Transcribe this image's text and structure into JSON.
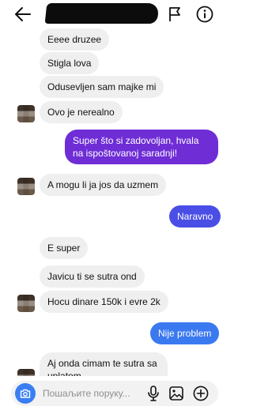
{
  "header": {
    "back_icon": "arrow-left-icon",
    "flag_icon": "flag-icon",
    "info_icon": "info-circle-icon"
  },
  "messages": [
    {
      "from": "them",
      "text": "Eeee druzee"
    },
    {
      "from": "them",
      "text": "Stigla lova"
    },
    {
      "from": "them",
      "text": "Odusevljen sam majke mi"
    },
    {
      "from": "them",
      "text": "Ovo je nerealno"
    },
    {
      "from": "me",
      "text": "Super što si zadovoljan, hvala na ispoštovanoj saradnji!"
    },
    {
      "from": "them",
      "text": "A mogu li ja jos da uzmem"
    },
    {
      "from": "me",
      "text": "Naravno"
    },
    {
      "from": "them",
      "text": "E super"
    },
    {
      "from": "them",
      "text": "Javicu ti se sutra ond"
    },
    {
      "from": "them",
      "text": "Hocu dinare 150k i evre 2k"
    },
    {
      "from": "me",
      "text": "Nije problem"
    },
    {
      "from": "them",
      "text": "Aj onda cimam te sutra sa uplatom"
    }
  ],
  "colors": {
    "incoming_bubble": "#efefef",
    "outgoing_purple": "#6f2dd6",
    "outgoing_indigo": "#4a4ee6",
    "outgoing_blue": "#3b79f0",
    "camera_button": "#3b7ef3"
  },
  "composer": {
    "placeholder": "Пошаљите поруку...",
    "camera_icon": "camera-icon",
    "mic_icon": "microphone-icon",
    "image_icon": "image-icon",
    "plus_icon": "plus-circle-icon"
  }
}
